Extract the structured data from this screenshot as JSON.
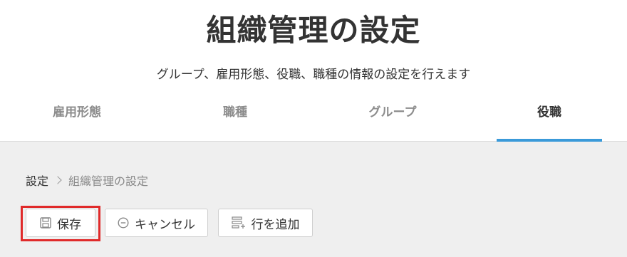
{
  "header": {
    "title": "組織管理の設定",
    "subtitle": "グループ、雇用形態、役職、職種の情報の設定を行えます"
  },
  "tabs": [
    {
      "label": "雇用形態",
      "active": false
    },
    {
      "label": "職種",
      "active": false
    },
    {
      "label": "グループ",
      "active": false
    },
    {
      "label": "役職",
      "active": true
    }
  ],
  "breadcrumb": {
    "root": "設定",
    "current": "組織管理の設定"
  },
  "toolbar": {
    "save_label": "保存",
    "save_icon": "floppy-disk-icon",
    "cancel_label": "キャンセル",
    "cancel_icon": "minus-circle-icon",
    "add_row_label": "行を追加",
    "add_row_icon": "add-rows-icon"
  },
  "colors": {
    "accent": "#3a9ad9",
    "highlight": "#e02a2a",
    "background": "#efefef"
  }
}
